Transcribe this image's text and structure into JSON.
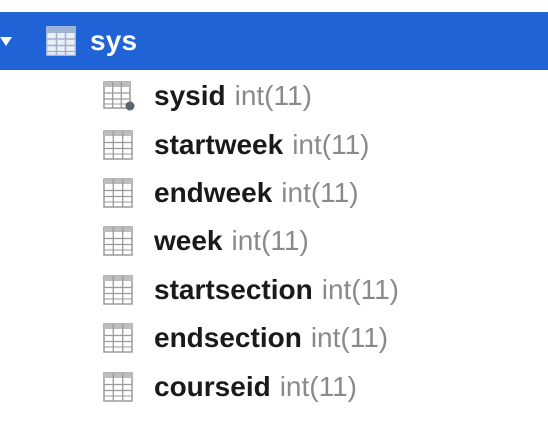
{
  "table": {
    "name": "sys",
    "expanded": true,
    "selected": true,
    "icon": "table-icon",
    "highlight_color": "#1f63d6"
  },
  "columns": [
    {
      "name": "sysid",
      "type": "int(11)",
      "is_key": true,
      "icon": "primary-key-column-icon"
    },
    {
      "name": "startweek",
      "type": "int(11)",
      "is_key": false,
      "icon": "column-icon"
    },
    {
      "name": "endweek",
      "type": "int(11)",
      "is_key": false,
      "icon": "column-icon"
    },
    {
      "name": "week",
      "type": "int(11)",
      "is_key": false,
      "icon": "column-icon"
    },
    {
      "name": "startsection",
      "type": "int(11)",
      "is_key": false,
      "icon": "column-icon"
    },
    {
      "name": "endsection",
      "type": "int(11)",
      "is_key": false,
      "icon": "column-icon"
    },
    {
      "name": "courseid",
      "type": "int(11)",
      "is_key": false,
      "icon": "column-icon"
    }
  ]
}
